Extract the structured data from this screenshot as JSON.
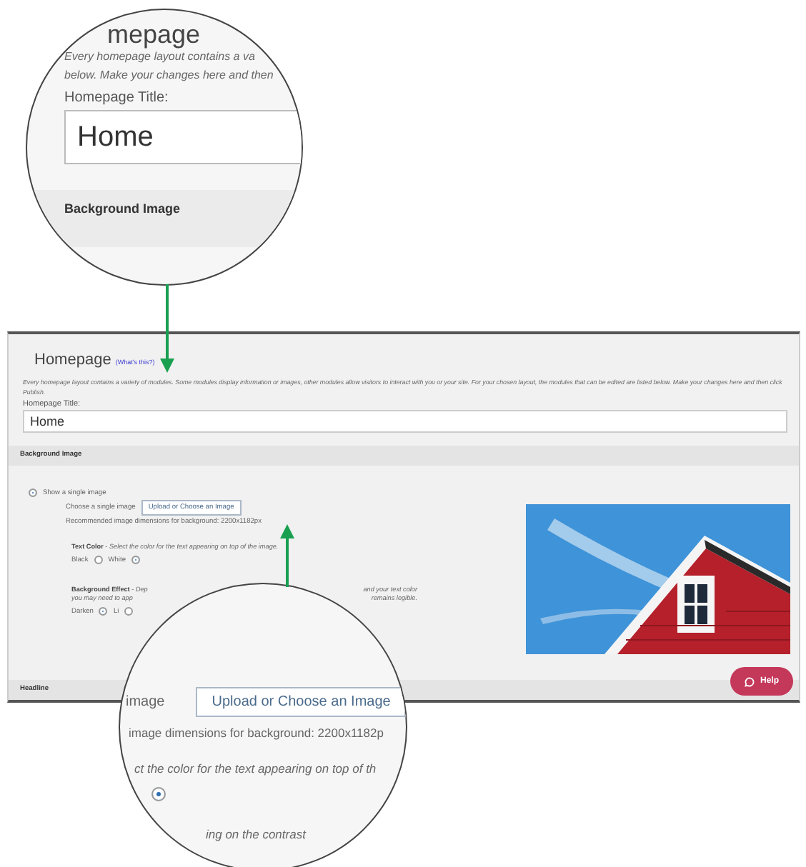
{
  "zoom_top": {
    "heading": "mepage",
    "description_lines": [
      "Every homepage layout contains a va",
      "below. Make your changes here and then"
    ],
    "title_label": "Homepage Title:",
    "title_value": "Home",
    "section": "Background Image"
  },
  "panel": {
    "heading": "Homepage",
    "help_link": "(What's this?)",
    "description": "Every homepage layout contains a variety of modules. Some modules display information or images, other modules allow visitors to interact with you or your site. For your chosen layout, the modules that can be edited are listed below. Make your changes here and then click Publish.",
    "title_label": "Homepage Title:",
    "title_value": "Home",
    "section": "Background Image",
    "image_mode": {
      "label": "Show a single image",
      "selected": true
    },
    "choose_label": "Choose a single image",
    "upload_button": "Upload or Choose an Image",
    "dimensions": "Recommended image dimensions for background: 2200x1182px",
    "text_color_text": "**Text Color** - *Select the color for the text appearing on top of the image.*",
    "text_color_options": [
      {
        "label": "Black",
        "selected": false
      },
      {
        "label": "White",
        "selected": true
      }
    ],
    "effect_lines": [
      [
        "**Background Effect** - *Dep*",
        "*and your text color*"
      ],
      [
        "*you may need to app*",
        "*remains legible.*"
      ]
    ],
    "effect_options": [
      {
        "label": "Darken",
        "selected": true
      },
      {
        "label": "Li",
        "selected": false
      }
    ],
    "next_section": "Headline",
    "help_button": "Help"
  },
  "zoom_bottom": {
    "label": "image",
    "upload_button": "Upload or Choose an Image",
    "dimensions": "image dimensions for background: 2200x1182p",
    "color_text": "ct the color for the text appearing on top of th",
    "radio": {
      "selected": true
    },
    "last_line": "ing on the contrast"
  }
}
